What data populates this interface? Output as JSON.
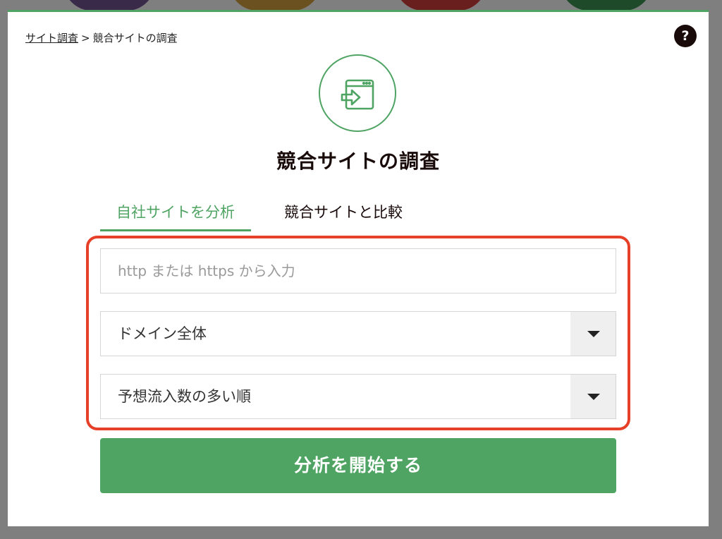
{
  "breadcrumb": {
    "root": "サイト調査",
    "separator": ">",
    "current": "競合サイトの調査"
  },
  "help": {
    "label": "?"
  },
  "header": {
    "icon": "site-entry-icon",
    "title": "競合サイトの調査"
  },
  "tabs": [
    {
      "label": "自社サイトを分析",
      "active": true
    },
    {
      "label": "競合サイトと比較",
      "active": false
    }
  ],
  "form": {
    "url_input": {
      "value": "",
      "placeholder": "http または https から入力"
    },
    "scope_select": {
      "value": "ドメイン全体",
      "icon": "chevron-down-icon"
    },
    "sort_select": {
      "value": "予想流入数の多い順",
      "icon": "chevron-down-icon"
    },
    "submit_label": "分析を開始する"
  },
  "colors": {
    "accent": "#4fa463",
    "highlight": "#e64029",
    "dark": "#1a0b0b"
  }
}
